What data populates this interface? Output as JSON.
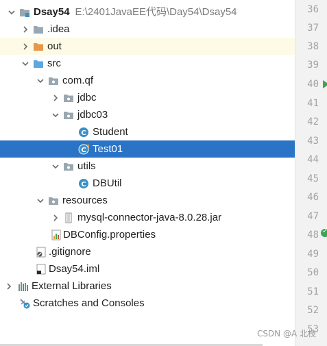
{
  "project_root": {
    "name": "Dsay54",
    "path": "E:\\2401JavaEE代码\\Day54\\Dsay54"
  },
  "tree": {
    "idea": ".idea",
    "out": "out",
    "src": "src",
    "com_qf": "com.qf",
    "jdbc": "jdbc",
    "jdbc03": "jdbc03",
    "student": "Student",
    "test01": "Test01",
    "utils": "utils",
    "dbutil": "DBUtil",
    "resources": "resources",
    "mysql_jar": "mysql-connector-java-8.0.28.jar",
    "dbconfig": "DBConfig.properties",
    "gitignore": ".gitignore",
    "iml": "Dsay54.iml",
    "external_libraries": "External Libraries",
    "scratches": "Scratches and Consoles"
  },
  "gutter": {
    "line_numbers": [
      "36",
      "37",
      "38",
      "39",
      "40",
      "41",
      "42",
      "43",
      "44",
      "45",
      "46",
      "47",
      "48",
      "49",
      "50",
      "51",
      "52",
      "53"
    ]
  },
  "watermark": "CSDN @A 北枝",
  "colors": {
    "selection": "#2a73c6",
    "folder": "#9aa7b0",
    "source_folder": "#59a8e0",
    "excluded_folder": "#e7964a",
    "class_icon": "#3b90c7",
    "run": "#3aa656"
  },
  "icons": {
    "module": "module-folder-icon",
    "folder": "folder-icon",
    "excluded_folder": "excluded-folder-icon",
    "source_folder": "source-folder-icon",
    "package": "package-icon",
    "class": "class-icon",
    "runnable_class": "runnable-class-icon",
    "jar": "jar-icon",
    "properties": "properties-file-icon",
    "gitignore": "gitignore-file-icon",
    "iml": "iml-file-icon",
    "libraries": "libraries-icon",
    "scratches": "scratches-icon"
  }
}
